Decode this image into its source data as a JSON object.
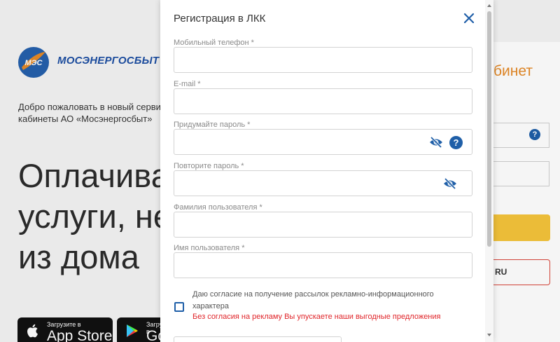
{
  "background": {
    "brand_name": "МОСЭНЕРГОСБЫТ",
    "logo_text": "МЭС",
    "welcome_line1": "Добро пожаловать в новый сервис личного",
    "welcome_line2": "кабинеты АО «Мосэнергосбыт»",
    "hero_line1": "Оплачивайте",
    "hero_line2": "услуги, не выходя",
    "hero_line3": "из дома",
    "appstore_small": "Загрузите в",
    "appstore_big": "App Store",
    "googleplay_small": "Загрузите в",
    "googleplay_big": "Google Play",
    "right_title": "бинет",
    "right_button_text": "RU"
  },
  "modal": {
    "title": "Регистрация в ЛКК",
    "fields": [
      {
        "label": "Мобильный телефон *",
        "value": "",
        "placeholder": ""
      },
      {
        "label": "E-mail *",
        "value": "",
        "placeholder": ""
      },
      {
        "label": "Придумайте пароль *",
        "value": "",
        "placeholder": ""
      },
      {
        "label": "Повторите пароль *",
        "value": "",
        "placeholder": ""
      },
      {
        "label": "Фамилия пользователя *",
        "value": "",
        "placeholder": ""
      },
      {
        "label": "Имя пользователя *",
        "value": "",
        "placeholder": ""
      }
    ],
    "help_glyph": "?",
    "consent_text": "Даю согласие на получение рассылок рекламно-информационного характера",
    "consent_warning": "Без согласия на рекламу Вы упускаете наши выгодные предложения",
    "consent_checked": false
  },
  "colors": {
    "brand_blue": "#1f5fa8",
    "accent_orange": "#e58a27",
    "warning_red": "#e0252a",
    "button_yellow": "#f5c43b"
  },
  "icons": [
    "close-icon",
    "eye-slash-icon",
    "help-icon",
    "apple-icon",
    "google-play-icon",
    "logo-icon"
  ]
}
